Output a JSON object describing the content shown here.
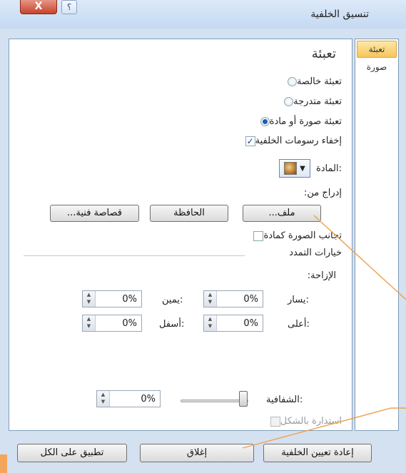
{
  "window": {
    "title": "تنسيق الخلفية",
    "help_label": "؟",
    "close_label": "X"
  },
  "nav": {
    "items": [
      {
        "label": "تعبئة",
        "active": true
      },
      {
        "label": "صورة",
        "active": false
      }
    ]
  },
  "fill": {
    "heading": "تعبئة",
    "options": [
      {
        "label": "تعبئة خالصة",
        "checked": false
      },
      {
        "label": "تعبئة متدرجة",
        "checked": false
      },
      {
        "label": "تعبئة صورة أو مادة",
        "checked": true
      }
    ],
    "hide_background": {
      "label": "إخفاء رسومات الخلفية",
      "checked": true
    },
    "material_label": "المادة:",
    "insert_from_label": "إدراج من:",
    "buttons": {
      "file": "ملف...",
      "clipboard": "الحافظة",
      "clipart": "قصاصة فنية..."
    },
    "tile_picture": {
      "label": "تجانب الصورة كمادة",
      "checked": false
    },
    "stretch_options_label": "خيارات التمدد",
    "offsets_label": "الإزاحة:",
    "offsets": {
      "left": {
        "label": "يسار:",
        "value": "0%"
      },
      "right": {
        "label": "يمين:",
        "value": "0%"
      },
      "top": {
        "label": "أعلى:",
        "value": "0%"
      },
      "bottom": {
        "label": "أسفل:",
        "value": "0%"
      }
    },
    "transparency": {
      "label": "الشفافية:",
      "value": "0%"
    },
    "rotate_with_shape": {
      "label": "استدارة بالشكل",
      "checked": false,
      "disabled": true
    }
  },
  "footer": {
    "reset": "إعادة تعيين الخلفية",
    "close": "إغلاق",
    "apply_all": "تطبيق على الكل"
  },
  "colors": {
    "accent": "#f0a04a",
    "frame": "#d4e1f1",
    "nav_active": "#f7c55a"
  }
}
